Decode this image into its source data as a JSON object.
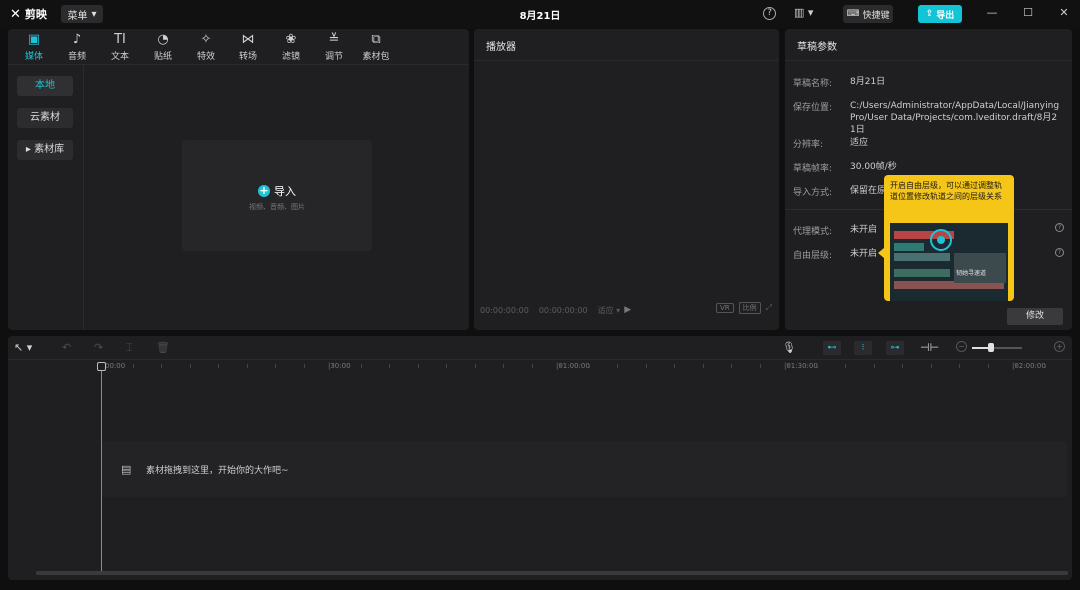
{
  "app": {
    "logo": "剪映",
    "menu_label": "菜单",
    "title": "8月21日",
    "shortcut_label": "快捷键",
    "export_label": "导出"
  },
  "media_toolbar": [
    {
      "label": "媒体",
      "icon": "media-icon",
      "glyph": "▣"
    },
    {
      "label": "音频",
      "icon": "audio-icon",
      "glyph": "♪"
    },
    {
      "label": "文本",
      "icon": "text-icon",
      "glyph": "TI"
    },
    {
      "label": "贴纸",
      "icon": "sticker-icon",
      "glyph": "◔"
    },
    {
      "label": "特效",
      "icon": "effects-icon",
      "glyph": "✧"
    },
    {
      "label": "转场",
      "icon": "transition-icon",
      "glyph": "⋈"
    },
    {
      "label": "滤镜",
      "icon": "filter-icon",
      "glyph": "❀"
    },
    {
      "label": "调节",
      "icon": "adjust-icon",
      "glyph": "≚"
    },
    {
      "label": "素材包",
      "icon": "asset-pack-icon",
      "glyph": "⧉"
    }
  ],
  "media_side": {
    "local": "本地",
    "cloud": "云素材",
    "library": "▸ 素材库"
  },
  "import": {
    "label": "导入",
    "sub": "视频、音频、图片"
  },
  "player": {
    "title": "播放器",
    "time_current": "00:00:00:00",
    "time_total": "00:00:00:00",
    "fit_label": "适应 ▾",
    "ratio_label": "比例",
    "vr_label": "VR"
  },
  "params": {
    "title": "草稿参数",
    "rows": [
      {
        "key": "草稿名称:",
        "value": "8月21日"
      },
      {
        "key": "保存位置:",
        "value": "C:/Users/Administrator/AppData/Local/JianyingPro/User Data/Projects/com.lveditor.draft/8月21日"
      },
      {
        "key": "分辨率:",
        "value": "适应"
      },
      {
        "key": "草稿帧率:",
        "value": "30.00帧/秒"
      },
      {
        "key": "导入方式:",
        "value": "保留在原"
      },
      {
        "key": "代理模式:",
        "value": "未开启"
      },
      {
        "key": "自由层级:",
        "value": "未开启"
      }
    ],
    "modify_label": "修改"
  },
  "tooltip": {
    "text": "开启自由层级，可以通过调整轨道位置修改轨道之间的层级关系",
    "image_caption": "韧她寻速道"
  },
  "timeline": {
    "ruler": [
      "00:00",
      "|30:00",
      "|01:00:00",
      "|01:30:00",
      "|02:00:00"
    ],
    "drop_text": "素材拖拽到这里，开始你的大作吧~"
  },
  "colors": {
    "accent": "#1fc3d6",
    "tooltip": "#f5c518",
    "panel": "#1f1f21",
    "background": "#0f0f10"
  }
}
